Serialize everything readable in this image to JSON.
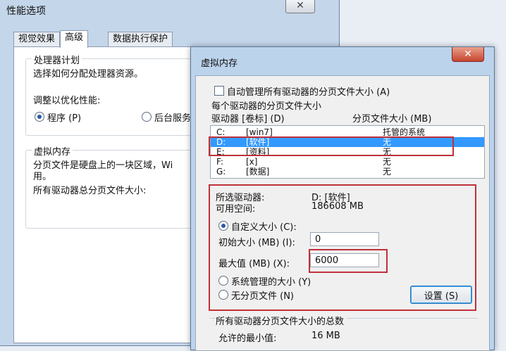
{
  "perf_window": {
    "title": "性能选项",
    "close_glyph": "✕",
    "tabs": [
      "视觉效果",
      "高级",
      "数据执行保护"
    ],
    "processor_group": {
      "legend": "处理器计划",
      "desc": "选择如何分配处理器资源。",
      "adjust_label": "调整以优化性能:",
      "radio_programs": "程序 (P)",
      "radio_background": "后台服务"
    },
    "vm_group": {
      "legend": "虚拟内存",
      "desc_line1": "分页文件是硬盘上的一块区域，Wi",
      "desc_line2": "用。",
      "total_label": "所有驱动器总分页文件大小:"
    }
  },
  "vm_window": {
    "title": "虚拟内存",
    "close_glyph": "✕",
    "auto_manage_label": "自动管理所有驱动器的分页文件大小 (A)",
    "per_drive_label": "每个驱动器的分页文件大小",
    "columns": [
      "驱动器 [卷标] (D)",
      "分页文件大小 (MB)"
    ],
    "drives": [
      {
        "drive": "C:",
        "label": "[win7]",
        "size": "托管的系统"
      },
      {
        "drive": "D:",
        "label": "[软件]",
        "size": "无"
      },
      {
        "drive": "E:",
        "label": "[资料]",
        "size": "无"
      },
      {
        "drive": "F:",
        "label": "[x]",
        "size": "无"
      },
      {
        "drive": "G:",
        "label": "[数据]",
        "size": "无"
      }
    ],
    "selected_drive_label": "所选驱动器:",
    "selected_drive_value": "D:  [软件]",
    "free_space_label": "可用空间:",
    "free_space_value": "186608 MB",
    "custom_size_label": "自定义大小 (C):",
    "initial_size_label": "初始大小 (MB) (I):",
    "initial_size_value": "0",
    "max_size_label": "最大值 (MB) (X):",
    "max_size_value": "6000",
    "system_managed_label": "系统管理的大小 (Y)",
    "no_paging_label": "无分页文件 (N)",
    "set_button": "设置 (S)",
    "totals_label": "所有驱动器分页文件大小的总数",
    "min_allowed_label": "允许的最小值:",
    "min_allowed_value": "16 MB"
  }
}
